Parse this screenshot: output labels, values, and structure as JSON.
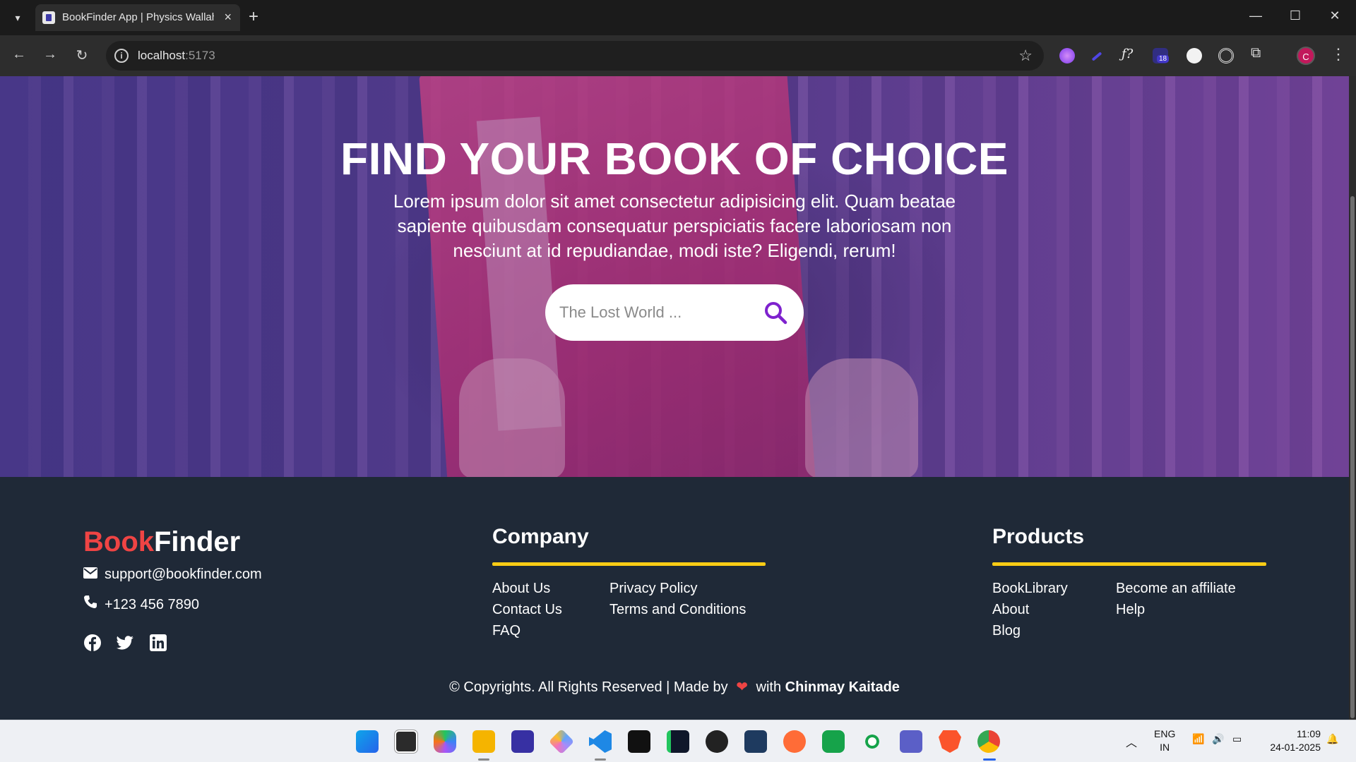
{
  "browser": {
    "tab_title": "BookFinder App | Physics Wallah",
    "url_host": "localhost",
    "url_port": ":5173",
    "extension_badge": "18",
    "profile_initial": "C"
  },
  "hero": {
    "heading": "FIND YOUR BOOK OF CHOICE",
    "description": "Lorem ipsum dolor sit amet consectetur adipisicing elit. Quam beatae sapiente quibusdam consequatur perspiciatis facere laboriosam non nesciunt at id repudiandae, modi iste? Eligendi, rerum!",
    "search_placeholder": "The Lost World ..."
  },
  "footer": {
    "brand_part1": "Book",
    "brand_part2": "Finder",
    "email": "support@bookfinder.com",
    "phone": "+123 456 7890",
    "company": {
      "title": "Company",
      "links": [
        "About Us",
        "Contact Us",
        "FAQ",
        "Privacy Policy",
        "Terms and Conditions"
      ]
    },
    "products": {
      "title": "Products",
      "links": [
        "BookLibrary",
        "About",
        "Blog",
        "Become an affiliate",
        "Help"
      ]
    },
    "copyright_prefix": "© Copyrights. All Rights Reserved | Made by",
    "copyright_with": "with",
    "author": "Chinmay Kaitade"
  },
  "taskbar": {
    "lang_line1": "ENG",
    "lang_line2": "IN",
    "time": "11:09",
    "date": "24-01-2025"
  },
  "colors": {
    "brand_red": "#ef4444",
    "accent_yellow": "#facc15",
    "footer_bg": "#1f2937",
    "search_icon": "#7e22ce"
  }
}
